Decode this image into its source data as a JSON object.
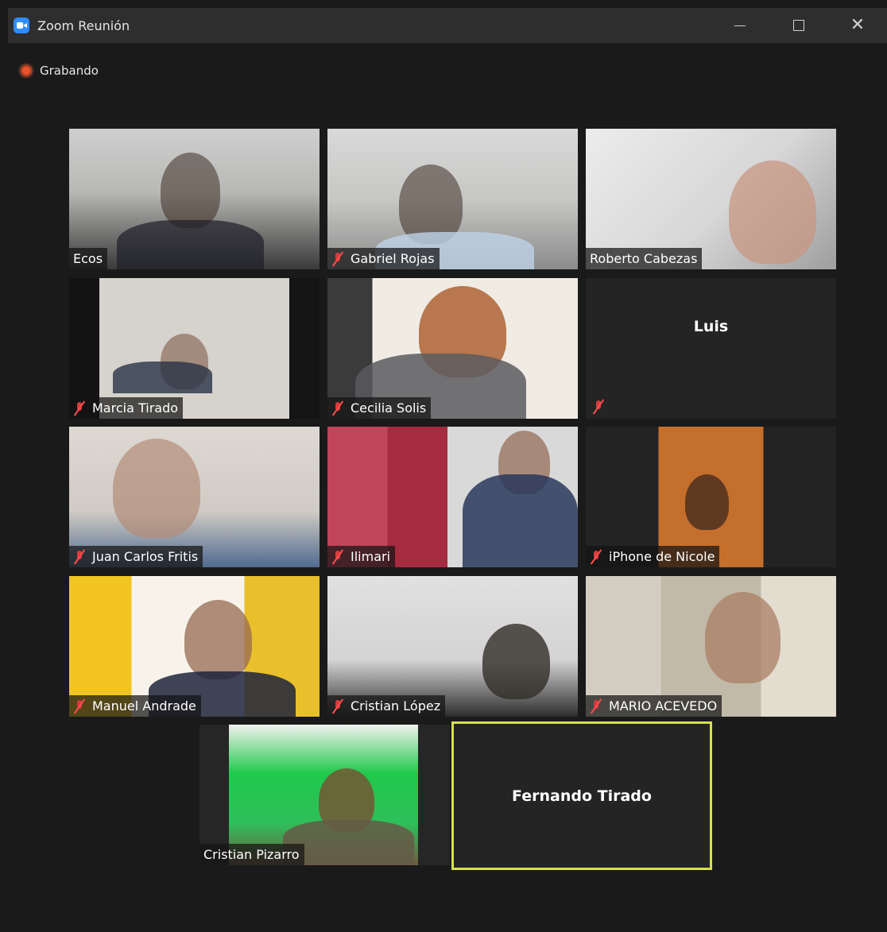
{
  "window": {
    "title": "Zoom Reunión",
    "icon": "zoom-camera-icon",
    "controls": {
      "minimize": "minimize-icon",
      "maximize": "maximize-icon",
      "close": "close-icon"
    }
  },
  "recording": {
    "label": "Grabando",
    "color": "#e8542c"
  },
  "participants": [
    {
      "name": "Ecos",
      "muted": false,
      "video": true
    },
    {
      "name": "Gabriel Rojas",
      "muted": true,
      "video": true
    },
    {
      "name": "Roberto Cabezas",
      "muted": false,
      "video": true
    },
    {
      "name": "Marcia Tirado",
      "muted": true,
      "video": true
    },
    {
      "name": "Cecilia Solis",
      "muted": true,
      "video": true
    },
    {
      "name": "Luis",
      "muted": true,
      "video": false
    },
    {
      "name": "Juan Carlos Fritis",
      "muted": true,
      "video": true
    },
    {
      "name": "Ilimari",
      "muted": true,
      "video": true
    },
    {
      "name": "iPhone de Nicole",
      "muted": true,
      "video": true
    },
    {
      "name": "Manuel Andrade",
      "muted": true,
      "video": true
    },
    {
      "name": "Cristian López",
      "muted": true,
      "video": true
    },
    {
      "name": "MARIO ACEVEDO",
      "muted": true,
      "video": true
    },
    {
      "name": "Cristian Pizarro",
      "muted": false,
      "video": true
    },
    {
      "name": "Fernando Tirado",
      "muted": false,
      "video": false,
      "active_speaker": true
    }
  ],
  "colors": {
    "active_speaker_border": "#d6e04f",
    "muted_icon": "#d83b3b",
    "background": "#1a1a1a"
  }
}
